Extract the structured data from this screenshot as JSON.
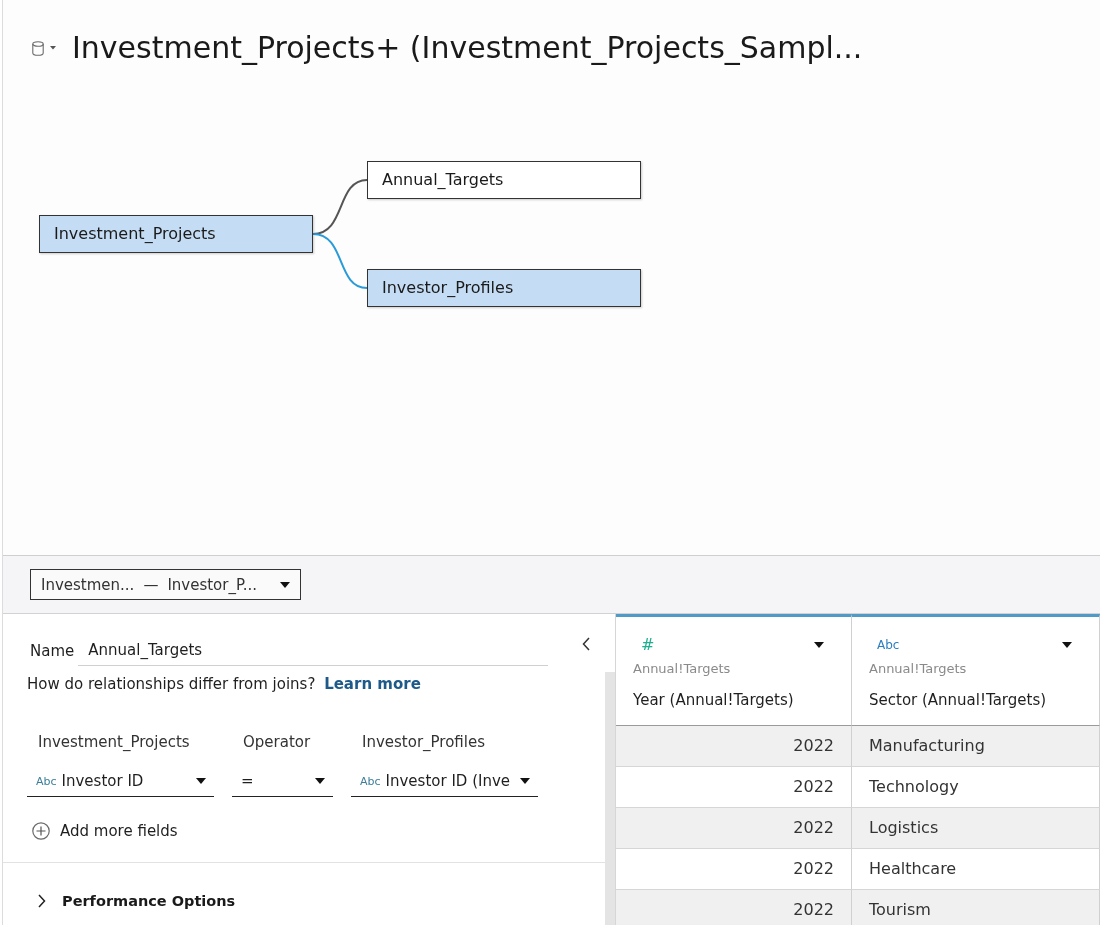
{
  "title_bar": {
    "title": "Investment_Projects+ (Investment_Projects_Sampl..."
  },
  "diagram": {
    "root": {
      "label": "Investment_Projects",
      "selected": true,
      "children": [
        {
          "label": "Annual_Targets",
          "selected": false
        },
        {
          "label": "Investor_Profiles",
          "selected": true
        }
      ]
    }
  },
  "relationship_selector": {
    "left": "Investmen...",
    "separator": "—",
    "right": "Investor_P..."
  },
  "details": {
    "name": {
      "label": "Name",
      "value": "Annual_Targets"
    },
    "help": {
      "text": "How do relationships differ from joins?",
      "link": "Learn more"
    },
    "field_columns": [
      "Investment_Projects",
      "Operator",
      "Investor_Profiles"
    ],
    "field_pairs": [
      {
        "left": {
          "type_label": "Abc",
          "value": "Investor ID"
        },
        "operator": "=",
        "right": {
          "type_label": "Abc",
          "value": "Investor ID (Inve"
        }
      }
    ],
    "add_fields": "Add more fields",
    "performance_options": {
      "label": "Performance Options",
      "expanded": false
    }
  },
  "grid": {
    "columns": [
      {
        "kind": "number",
        "type_label": "#",
        "source": "Annual!Targets",
        "name": "Year (Annual!Targets)"
      },
      {
        "kind": "string",
        "type_label": "Abc",
        "source": "Annual!Targets",
        "name": "Sector (Annual!Targets)"
      }
    ],
    "rows": [
      [
        "2022",
        "Manufacturing"
      ],
      [
        "2022",
        "Technology"
      ],
      [
        "2022",
        "Logistics"
      ],
      [
        "2022",
        "Healthcare"
      ],
      [
        "2022",
        "Tourism"
      ]
    ]
  }
}
